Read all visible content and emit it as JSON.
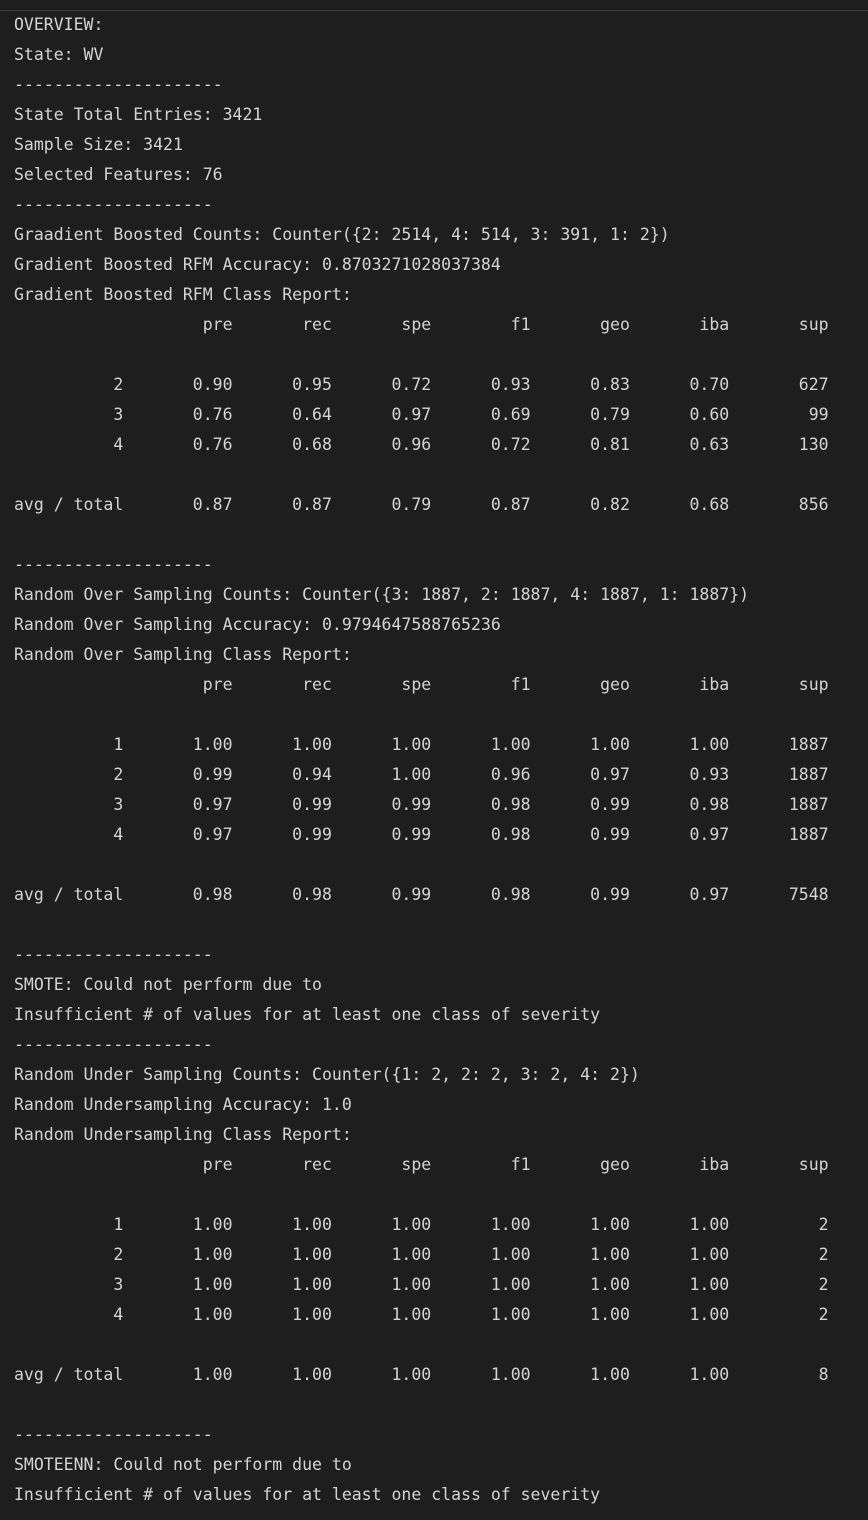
{
  "terminal": {
    "lines": [
      "OVERVIEW:",
      "State: WV",
      "---------------------",
      "State Total Entries: 3421",
      "Sample Size: 3421",
      "Selected Features: 76",
      "--------------------",
      "Graadient Boosted Counts: Counter({2: 2514, 4: 514, 3: 391, 1: 2})",
      "Gradient Boosted RFM Accuracy: 0.8703271028037384",
      "Gradient Boosted RFM Class Report:",
      "                   pre       rec       spe        f1       geo       iba       sup",
      "",
      "          2       0.90      0.95      0.72      0.93      0.83      0.70       627",
      "          3       0.76      0.64      0.97      0.69      0.79      0.60        99",
      "          4       0.76      0.68      0.96      0.72      0.81      0.63       130",
      "",
      "avg / total       0.87      0.87      0.79      0.87      0.82      0.68       856",
      "",
      "--------------------",
      "Random Over Sampling Counts: Counter({3: 1887, 2: 1887, 4: 1887, 1: 1887})",
      "Random Over Sampling Accuracy: 0.9794647588765236",
      "Random Over Sampling Class Report:",
      "                   pre       rec       spe        f1       geo       iba       sup",
      "",
      "          1       1.00      1.00      1.00      1.00      1.00      1.00      1887",
      "          2       0.99      0.94      1.00      0.96      0.97      0.93      1887",
      "          3       0.97      0.99      0.99      0.98      0.99      0.98      1887",
      "          4       0.97      0.99      0.99      0.98      0.99      0.97      1887",
      "",
      "avg / total       0.98      0.98      0.99      0.98      0.99      0.97      7548",
      "",
      "--------------------",
      "SMOTE: Could not perform due to",
      "Insufficient # of values for at least one class of severity",
      "--------------------",
      "Random Under Sampling Counts: Counter({1: 2, 2: 2, 3: 2, 4: 2})",
      "Random Undersampling Accuracy: 1.0",
      "Random Undersampling Class Report:",
      "                   pre       rec       spe        f1       geo       iba       sup",
      "",
      "          1       1.00      1.00      1.00      1.00      1.00      1.00         2",
      "          2       1.00      1.00      1.00      1.00      1.00      1.00         2",
      "          3       1.00      1.00      1.00      1.00      1.00      1.00         2",
      "          4       1.00      1.00      1.00      1.00      1.00      1.00         2",
      "",
      "avg / total       1.00      1.00      1.00      1.00      1.00      1.00         8",
      "",
      "--------------------",
      "SMOTEENN: Could not perform due to",
      "Insufficient # of values for at least one class of severity"
    ]
  }
}
